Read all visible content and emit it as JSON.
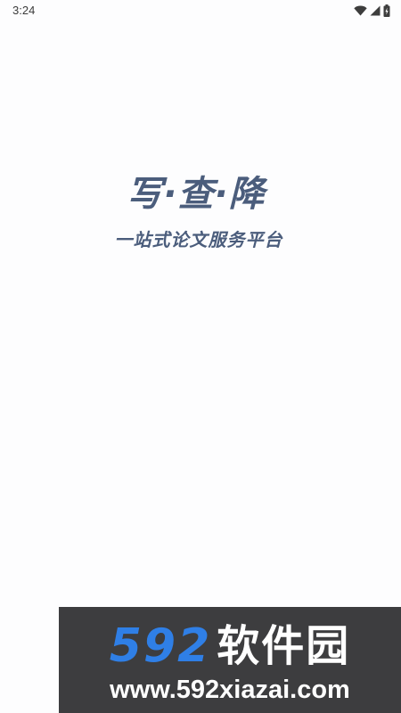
{
  "status_bar": {
    "time": "3:24",
    "icons": [
      "wifi-icon",
      "cellular-signal-icon",
      "battery-charging-icon"
    ]
  },
  "splash": {
    "title": "写·查·降",
    "subtitle": "一站式论文服务平台",
    "text_color": "#4b5d7c"
  },
  "watermark": {
    "number": "592",
    "brand": "软件园",
    "url": "www.592xiazai.com",
    "background_color": "#3d3d3f",
    "number_color": "#2f7fe6"
  }
}
